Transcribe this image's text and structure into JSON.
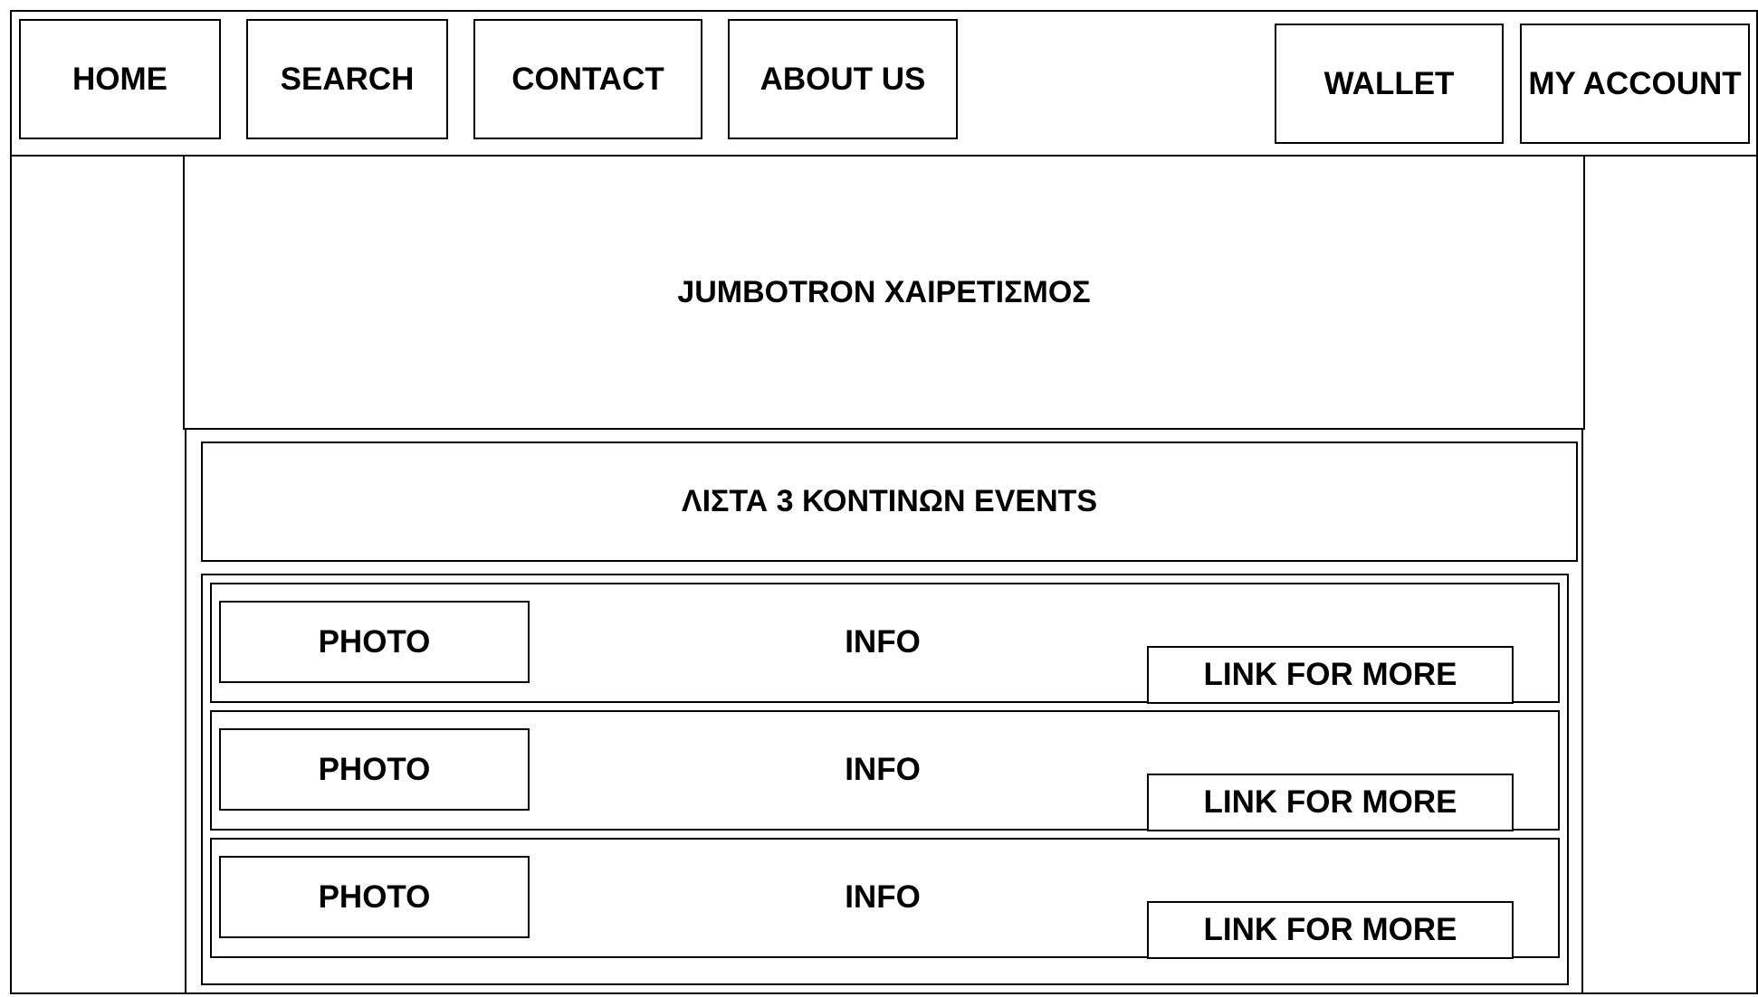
{
  "nav": {
    "home": "HOME",
    "search": "SEARCH",
    "contact": "CONTACT",
    "about": "ABOUT US",
    "wallet": "WALLET",
    "account": "MY ACCOUNT"
  },
  "jumbotron": {
    "text": "JUMBOTRON ΧΑΙΡΕΤΙΣΜΟΣ"
  },
  "events": {
    "title": "ΛΙΣΤΑ 3 ΚΟΝΤΙΝΩΝ EVENTS",
    "items": [
      {
        "photo": "PHOTO",
        "info": "INFO",
        "link": "LINK FOR MORE"
      },
      {
        "photo": "PHOTO",
        "info": "INFO",
        "link": "LINK FOR MORE"
      },
      {
        "photo": "PHOTO",
        "info": "INFO",
        "link": "LINK FOR MORE"
      }
    ]
  }
}
